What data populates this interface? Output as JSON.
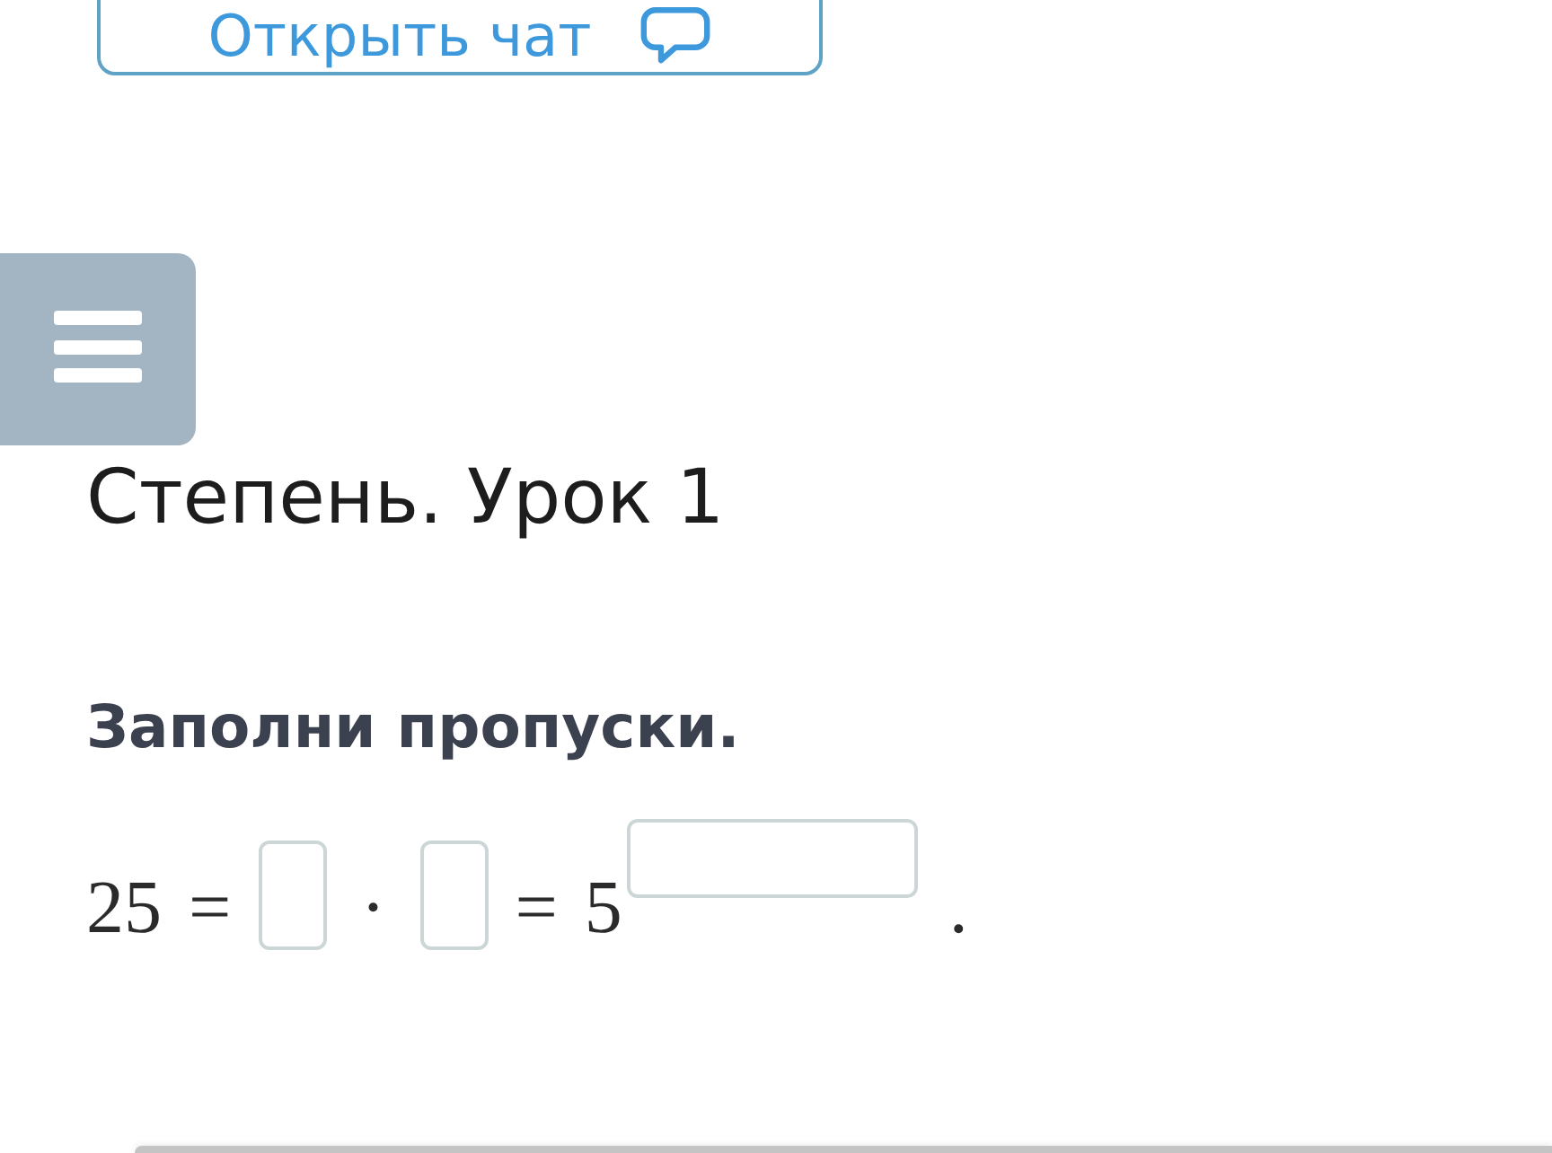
{
  "chat_button": {
    "label": "Открыть чат"
  },
  "lesson_title": "Степень. Урок 1",
  "task": {
    "instruction": "Заполни пропуски.",
    "equation": [
      {
        "kind": "number",
        "text": "25"
      },
      {
        "kind": "operator",
        "text": "="
      },
      {
        "kind": "blank"
      },
      {
        "kind": "operator",
        "text": "·"
      },
      {
        "kind": "blank"
      },
      {
        "kind": "operator",
        "text": "="
      },
      {
        "kind": "number",
        "text": "5"
      },
      {
        "kind": "exponent_blank"
      },
      {
        "kind": "punctuation",
        "text": "."
      }
    ]
  }
}
